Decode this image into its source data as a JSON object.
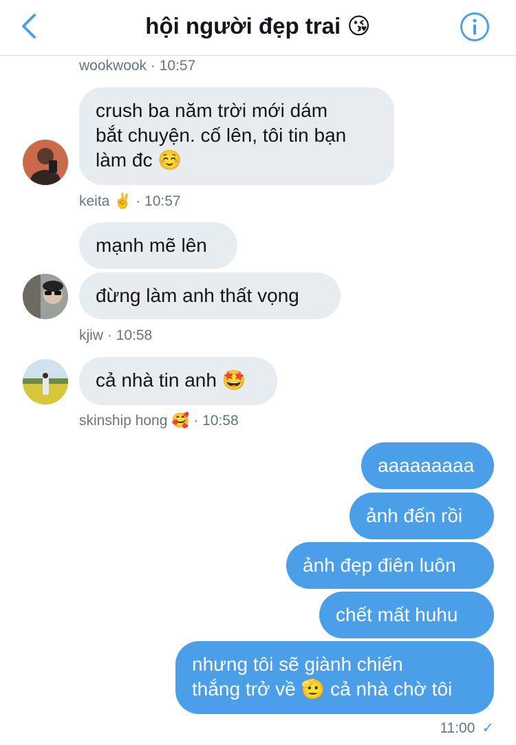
{
  "header": {
    "back_icon": "chevron-left-icon",
    "title": "hội người đẹp trai",
    "title_emoji": "😘",
    "info_icon": "info-circle-icon",
    "accent_color": "#4a9fe8"
  },
  "messages_in": [
    {
      "meta": "wookwook · 10:57",
      "text": "crush ba năm trời mới dám bắt chuyện. cố lên, tôi tin bạn làm đc",
      "text_line1": "crush ba năm trời mới dám",
      "text_line2": "bắt chuyện. cố lên, tôi tin bạn",
      "text_line3": "làm đc",
      "emoji": "☺️"
    },
    {
      "meta_name": "keita",
      "meta_emoji": "✌️",
      "meta_time": "· 10:57",
      "bubble1": "mạnh mẽ lên",
      "bubble2": "đừng làm anh thất vọng"
    },
    {
      "meta": "kjiw · 10:58",
      "bubble1": "cả nhà tin anh",
      "emoji": "🤩"
    },
    {
      "meta_name": "skinship hong",
      "meta_emoji": "🥰",
      "meta_time": "· 10:58"
    }
  ],
  "messages_out": [
    {
      "text": "aaaaaaaaa"
    },
    {
      "text": "ảnh đến rồi"
    },
    {
      "text": "ảnh đẹp điên luôn"
    },
    {
      "text": "chết mất huhu"
    },
    {
      "text_line1": "nhưng tôi sẽ giành chiến",
      "text_line2a": "thắng trở về",
      "emoji": "🫡",
      "text_line2b": "cả nhà chờ tôi"
    }
  ],
  "sent_status": {
    "time": "11:00",
    "check_icon": "checkmark-icon"
  },
  "colors": {
    "incoming_bubble": "#e6ecf0",
    "outgoing_bubble": "#4a9fe8",
    "meta_text": "#66757f"
  }
}
